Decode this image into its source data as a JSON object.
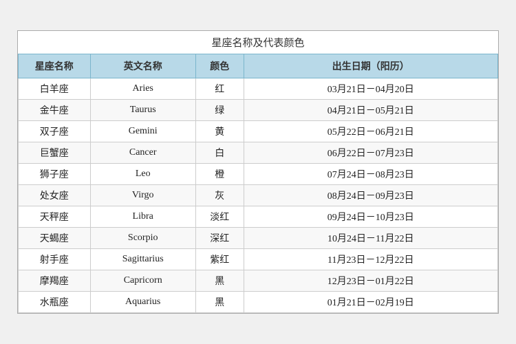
{
  "title": "星座名称及代表颜色",
  "headers": [
    "星座名称",
    "英文名称",
    "颜色",
    "出生日期（阳历）"
  ],
  "rows": [
    {
      "zh": "白羊座",
      "en": "Aries",
      "color": "红",
      "date": "03月21日－04月20日"
    },
    {
      "zh": "金牛座",
      "en": "Taurus",
      "color": "绿",
      "date": "04月21日－05月21日"
    },
    {
      "zh": "双子座",
      "en": "Gemini",
      "color": "黄",
      "date": "05月22日－06月21日"
    },
    {
      "zh": "巨蟹座",
      "en": "Cancer",
      "color": "白",
      "date": "06月22日－07月23日"
    },
    {
      "zh": "狮子座",
      "en": "Leo",
      "color": "橙",
      "date": "07月24日－08月23日"
    },
    {
      "zh": "处女座",
      "en": "Virgo",
      "color": "灰",
      "date": "08月24日－09月23日"
    },
    {
      "zh": "天秤座",
      "en": "Libra",
      "color": "淡红",
      "date": "09月24日－10月23日"
    },
    {
      "zh": "天蝎座",
      "en": "Scorpio",
      "color": "深红",
      "date": "10月24日－11月22日"
    },
    {
      "zh": "射手座",
      "en": "Sagittarius",
      "color": "紫红",
      "date": "11月23日－12月22日"
    },
    {
      "zh": "摩羯座",
      "en": "Capricorn",
      "color": "黑",
      "date": "12月23日－01月22日"
    },
    {
      "zh": "水瓶座",
      "en": "Aquarius",
      "color": "黑",
      "date": "01月21日－02月19日"
    }
  ]
}
